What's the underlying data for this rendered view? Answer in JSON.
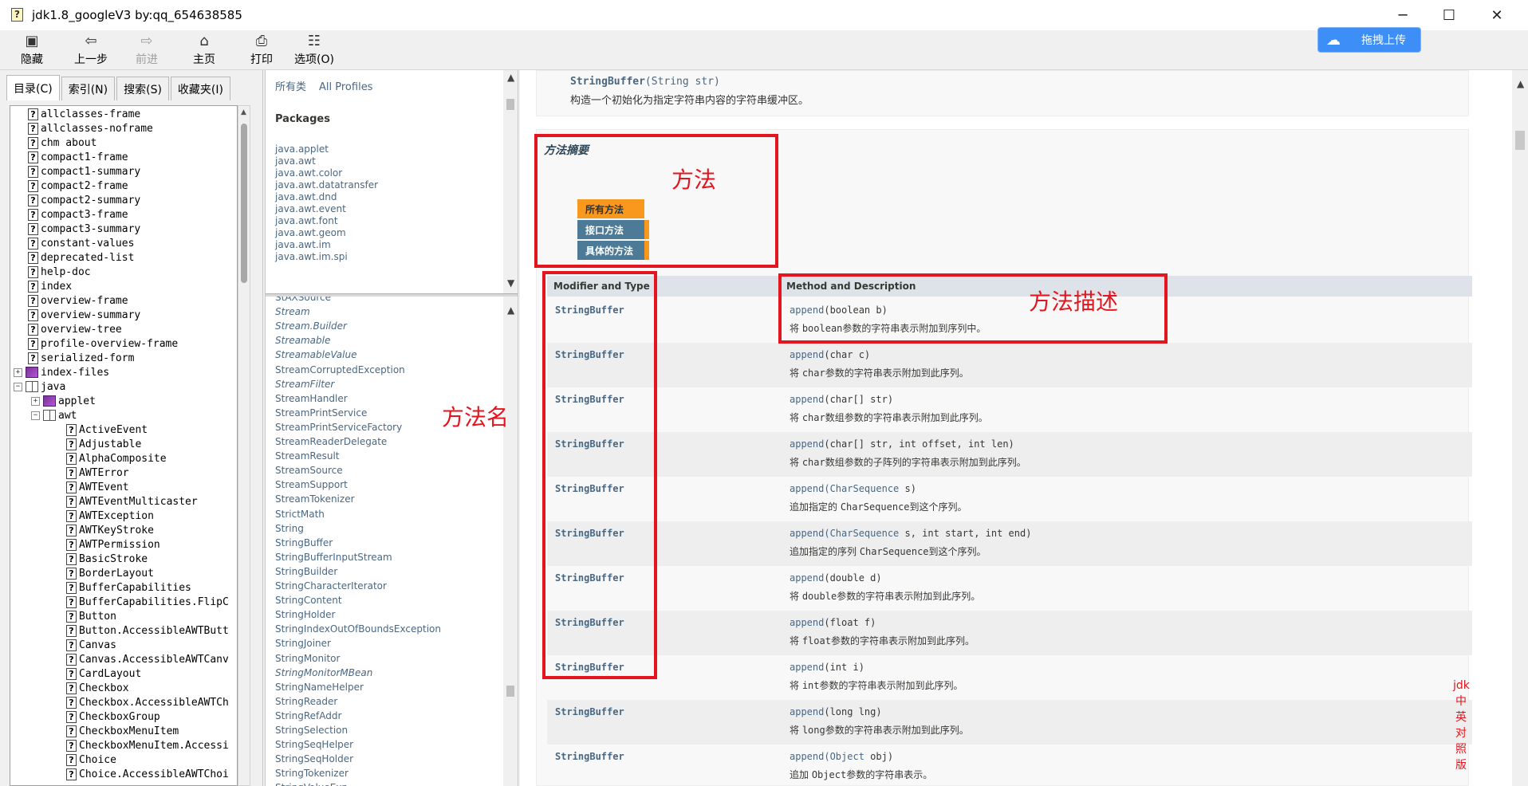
{
  "window": {
    "title": "jdk1.8_googleV3 by:qq_654638585",
    "controls": {
      "minimize": "─",
      "maximize": "☐",
      "close": "✕"
    }
  },
  "toolbar": [
    {
      "label": "隐藏",
      "icon": "hide-icon",
      "glyph": "▣",
      "enabled": true
    },
    {
      "label": "上一步",
      "icon": "back-arrow-icon",
      "glyph": "⇦",
      "enabled": true
    },
    {
      "label": "前进",
      "icon": "forward-arrow-icon",
      "glyph": "⇨",
      "enabled": false
    },
    {
      "label": "主页",
      "icon": "home-icon",
      "glyph": "⌂",
      "enabled": true
    },
    {
      "label": "打印",
      "icon": "printer-icon",
      "glyph": "⎙",
      "enabled": true
    },
    {
      "label": "选项(O)",
      "icon": "options-icon",
      "glyph": "☷",
      "enabled": true
    }
  ],
  "upload": {
    "label": "拖拽上传",
    "icon": "cloud-upload-icon",
    "glyph": "☁"
  },
  "nav_tabs": [
    "目录(C)",
    "索引(N)",
    "搜索(S)",
    "收藏夹(I)"
  ],
  "tree": [
    {
      "label": "allclasses-frame",
      "kind": "page",
      "indent": 0
    },
    {
      "label": "allclasses-noframe",
      "kind": "page",
      "indent": 0
    },
    {
      "label": "chm about",
      "kind": "page",
      "indent": 0
    },
    {
      "label": "compact1-frame",
      "kind": "page",
      "indent": 0
    },
    {
      "label": "compact1-summary",
      "kind": "page",
      "indent": 0
    },
    {
      "label": "compact2-frame",
      "kind": "page",
      "indent": 0
    },
    {
      "label": "compact2-summary",
      "kind": "page",
      "indent": 0
    },
    {
      "label": "compact3-frame",
      "kind": "page",
      "indent": 0
    },
    {
      "label": "compact3-summary",
      "kind": "page",
      "indent": 0
    },
    {
      "label": "constant-values",
      "kind": "page",
      "indent": 0
    },
    {
      "label": "deprecated-list",
      "kind": "page",
      "indent": 0
    },
    {
      "label": "help-doc",
      "kind": "page",
      "indent": 0
    },
    {
      "label": "index",
      "kind": "page",
      "indent": 0
    },
    {
      "label": "overview-frame",
      "kind": "page",
      "indent": 0
    },
    {
      "label": "overview-summary",
      "kind": "page",
      "indent": 0
    },
    {
      "label": "overview-tree",
      "kind": "page",
      "indent": 0
    },
    {
      "label": "profile-overview-frame",
      "kind": "page",
      "indent": 0
    },
    {
      "label": "serialized-form",
      "kind": "page",
      "indent": 0
    },
    {
      "label": "index-files",
      "kind": "book",
      "indent": 0,
      "expander": "+"
    },
    {
      "label": "java",
      "kind": "book-open",
      "indent": 0,
      "expander": "−"
    },
    {
      "label": "applet",
      "kind": "book",
      "indent": 1,
      "expander": "+"
    },
    {
      "label": "awt",
      "kind": "book-open",
      "indent": 1,
      "expander": "−"
    },
    {
      "label": "ActiveEvent",
      "kind": "page",
      "indent": 2
    },
    {
      "label": "Adjustable",
      "kind": "page",
      "indent": 2
    },
    {
      "label": "AlphaComposite",
      "kind": "page",
      "indent": 2
    },
    {
      "label": "AWTError",
      "kind": "page",
      "indent": 2
    },
    {
      "label": "AWTEvent",
      "kind": "page",
      "indent": 2
    },
    {
      "label": "AWTEventMulticaster",
      "kind": "page",
      "indent": 2
    },
    {
      "label": "AWTException",
      "kind": "page",
      "indent": 2
    },
    {
      "label": "AWTKeyStroke",
      "kind": "page",
      "indent": 2
    },
    {
      "label": "AWTPermission",
      "kind": "page",
      "indent": 2
    },
    {
      "label": "BasicStroke",
      "kind": "page",
      "indent": 2
    },
    {
      "label": "BorderLayout",
      "kind": "page",
      "indent": 2
    },
    {
      "label": "BufferCapabilities",
      "kind": "page",
      "indent": 2
    },
    {
      "label": "BufferCapabilities.FlipC",
      "kind": "page",
      "indent": 2
    },
    {
      "label": "Button",
      "kind": "page",
      "indent": 2
    },
    {
      "label": "Button.AccessibleAWTButt",
      "kind": "page",
      "indent": 2
    },
    {
      "label": "Canvas",
      "kind": "page",
      "indent": 2
    },
    {
      "label": "Canvas.AccessibleAWTCanv",
      "kind": "page",
      "indent": 2
    },
    {
      "label": "CardLayout",
      "kind": "page",
      "indent": 2
    },
    {
      "label": "Checkbox",
      "kind": "page",
      "indent": 2
    },
    {
      "label": "Checkbox.AccessibleAWTCh",
      "kind": "page",
      "indent": 2
    },
    {
      "label": "CheckboxGroup",
      "kind": "page",
      "indent": 2
    },
    {
      "label": "CheckboxMenuItem",
      "kind": "page",
      "indent": 2
    },
    {
      "label": "CheckboxMenuItem.Accessi",
      "kind": "page",
      "indent": 2
    },
    {
      "label": "Choice",
      "kind": "page",
      "indent": 2
    },
    {
      "label": "Choice.AccessibleAWTChoi",
      "kind": "page",
      "indent": 2
    }
  ],
  "middle": {
    "header": [
      "所有类",
      "All Profiles"
    ],
    "packages_title": "Packages",
    "packages": [
      "java.applet",
      "java.awt",
      "java.awt.color",
      "java.awt.datatransfer",
      "java.awt.dnd",
      "java.awt.event",
      "java.awt.font",
      "java.awt.geom",
      "java.awt.im",
      "java.awt.im.spi"
    ],
    "classes": [
      {
        "name": "StAXSource",
        "italic": false
      },
      {
        "name": "Stream",
        "italic": true
      },
      {
        "name": "Stream.Builder",
        "italic": true
      },
      {
        "name": "Streamable",
        "italic": true
      },
      {
        "name": "StreamableValue",
        "italic": true
      },
      {
        "name": "StreamCorruptedException",
        "italic": false
      },
      {
        "name": "StreamFilter",
        "italic": true
      },
      {
        "name": "StreamHandler",
        "italic": false
      },
      {
        "name": "StreamPrintService",
        "italic": false
      },
      {
        "name": "StreamPrintServiceFactory",
        "italic": false
      },
      {
        "name": "StreamReaderDelegate",
        "italic": false
      },
      {
        "name": "StreamResult",
        "italic": false
      },
      {
        "name": "StreamSource",
        "italic": false
      },
      {
        "name": "StreamSupport",
        "italic": false
      },
      {
        "name": "StreamTokenizer",
        "italic": false
      },
      {
        "name": "StrictMath",
        "italic": false
      },
      {
        "name": "String",
        "italic": false
      },
      {
        "name": "StringBuffer",
        "italic": false
      },
      {
        "name": "StringBufferInputStream",
        "italic": false
      },
      {
        "name": "StringBuilder",
        "italic": false
      },
      {
        "name": "StringCharacterIterator",
        "italic": false
      },
      {
        "name": "StringContent",
        "italic": false
      },
      {
        "name": "StringHolder",
        "italic": false
      },
      {
        "name": "StringIndexOutOfBoundsException",
        "italic": false
      },
      {
        "name": "StringJoiner",
        "italic": false
      },
      {
        "name": "StringMonitor",
        "italic": false
      },
      {
        "name": "StringMonitorMBean",
        "italic": true
      },
      {
        "name": "StringNameHelper",
        "italic": false
      },
      {
        "name": "StringReader",
        "italic": false
      },
      {
        "name": "StringRefAddr",
        "italic": false
      },
      {
        "name": "StringSelection",
        "italic": false
      },
      {
        "name": "StringSeqHelper",
        "italic": false
      },
      {
        "name": "StringSeqHolder",
        "italic": false
      },
      {
        "name": "StringTokenizer",
        "italic": false
      },
      {
        "name": "StringValueExp",
        "italic": false
      }
    ]
  },
  "content": {
    "ctor": {
      "sig_name": "StringBuffer",
      "sig_args": "(String str)",
      "sig_type": "String",
      "sig_rest": " str)",
      "desc": "构造一个初始化为指定字符串内容的字符串缓冲区。"
    },
    "summary_title": "方法摘要",
    "method_tabs": [
      "所有方法",
      "接口方法",
      "具体的方法"
    ],
    "table_headers": [
      "Modifier and Type",
      "Method and Description"
    ],
    "methods": [
      {
        "type": "StringBuffer",
        "name": "append",
        "args": "(boolean b)",
        "desc_pre": "将 ",
        "desc_code": "boolean",
        "desc_post": "参数的字符串表示附加到序列中。"
      },
      {
        "type": "StringBuffer",
        "name": "append",
        "args": "(char c)",
        "desc_pre": "将 ",
        "desc_code": "char",
        "desc_post": "参数的字符串表示附加到此序列。"
      },
      {
        "type": "StringBuffer",
        "name": "append",
        "args": "(char[] str)",
        "desc_pre": "将 ",
        "desc_code": "char",
        "desc_post": "数组参数的字符串表示附加到此序列。"
      },
      {
        "type": "StringBuffer",
        "name": "append",
        "args": "(char[] str, int offset, int len)",
        "desc_pre": "将 ",
        "desc_code": "char",
        "desc_post": "数组参数的子阵列的字符串表示附加到此序列。"
      },
      {
        "type": "StringBuffer",
        "name": "append",
        "args_link": "(CharSequence",
        "args": " s)",
        "desc_pre": "追加指定的 ",
        "desc_code": "CharSequence",
        "desc_post": "到这个序列。"
      },
      {
        "type": "StringBuffer",
        "name": "append",
        "args_link": "(CharSequence",
        "args": " s, int start, int end)",
        "desc_pre": "追加指定的序列 ",
        "desc_code": "CharSequence",
        "desc_post": "到这个序列。"
      },
      {
        "type": "StringBuffer",
        "name": "append",
        "args": "(double d)",
        "desc_pre": "将 ",
        "desc_code": "double",
        "desc_post": "参数的字符串表示附加到此序列。"
      },
      {
        "type": "StringBuffer",
        "name": "append",
        "args": "(float f)",
        "desc_pre": "将 ",
        "desc_code": "float",
        "desc_post": "参数的字符串表示附加到此序列。"
      },
      {
        "type": "StringBuffer",
        "name": "append",
        "args": "(int i)",
        "desc_pre": "将 ",
        "desc_code": "int",
        "desc_post": "参数的字符串表示附加到此序列。"
      },
      {
        "type": "StringBuffer",
        "name": "append",
        "args": "(long lng)",
        "desc_pre": "将 ",
        "desc_code": "long",
        "desc_post": "参数的字符串表示附加到此序列。"
      },
      {
        "type": "StringBuffer",
        "name": "append",
        "args_link": "(Object",
        "args": " obj)",
        "desc_pre": "追加 ",
        "desc_code": "Object",
        "desc_post": "参数的字符串表示。"
      }
    ]
  },
  "annotations": {
    "method_label": "方法",
    "method_name_label": "方法名",
    "method_desc_label": "方法描述",
    "side_label": "jdk中英对照版"
  },
  "colors": {
    "annotation_red": "#e3161f",
    "tab_orange": "#f8981d",
    "tab_blue": "#4d7a97",
    "link": "#4a6782"
  }
}
